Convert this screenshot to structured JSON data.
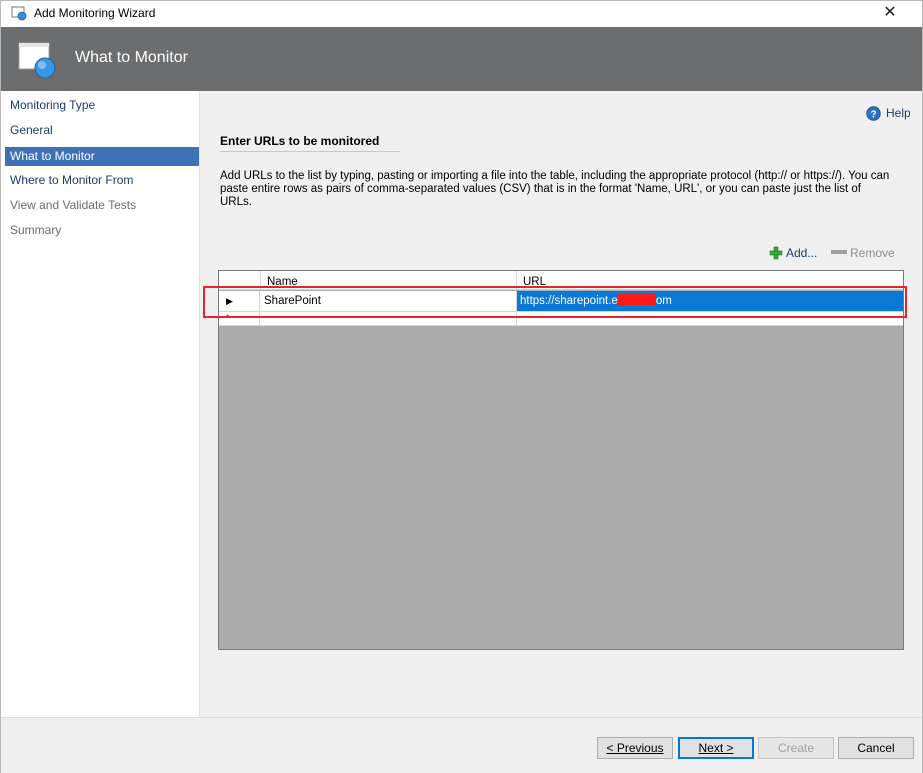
{
  "window": {
    "title": "Add Monitoring Wizard",
    "close_glyph": "✕"
  },
  "banner": {
    "heading": "What to Monitor"
  },
  "nav": {
    "items": [
      {
        "label": "Monitoring Type",
        "state": "done"
      },
      {
        "label": "General",
        "state": "done"
      },
      {
        "label": "What to Monitor",
        "state": "active"
      },
      {
        "label": "Where to Monitor From",
        "state": "done"
      },
      {
        "label": "View and Validate Tests",
        "state": "future"
      },
      {
        "label": "Summary",
        "state": "future"
      }
    ]
  },
  "main": {
    "help_label": "Help",
    "section_title": "Enter URLs to be monitored",
    "description": "Add URLs to the list by typing, pasting or importing a file into the table, including the appropriate protocol (http:// or https://). You can paste entire rows as pairs of comma-separated values (CSV) that is in the format 'Name, URL', or you can paste just the list of URLs.",
    "add_label": "Add...",
    "remove_label": "Remove"
  },
  "grid": {
    "columns": [
      "Name",
      "URL"
    ],
    "rows": [
      {
        "marker": "▶",
        "name": "SharePoint",
        "url_prefix": "https://sharepoint.e",
        "url_suffix": "om"
      }
    ],
    "new_row_marker": "*"
  },
  "footer": {
    "previous_label": "< Previous",
    "next_label": "Next >",
    "create_label": "Create",
    "cancel_label": "Cancel"
  },
  "colors": {
    "banner": "#6b6d6f",
    "nav_active": "#3e72b8",
    "selection": "#0a78d7",
    "highlight": "#e8232a"
  }
}
